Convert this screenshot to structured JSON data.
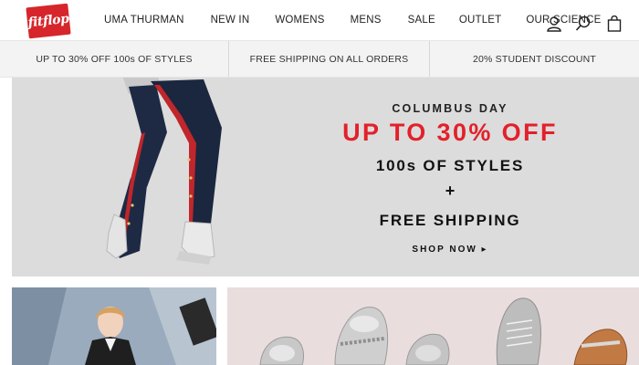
{
  "brand": {
    "logo_text": "fitflop",
    "logo_color": "#d6262b"
  },
  "nav": {
    "items": [
      {
        "label": "UMA THURMAN"
      },
      {
        "label": "NEW IN"
      },
      {
        "label": "WOMENS"
      },
      {
        "label": "MENS"
      },
      {
        "label": "SALE"
      },
      {
        "label": "OUTLET"
      },
      {
        "label": "OUR SCIENCE"
      }
    ]
  },
  "header_icons": [
    "account-icon",
    "search-icon",
    "bag-icon"
  ],
  "promo_bar": {
    "items": [
      {
        "label": "UP TO 30% OFF 100s OF STYLES"
      },
      {
        "label": "FREE SHIPPING ON ALL ORDERS"
      },
      {
        "label": "20% STUDENT DISCOUNT"
      }
    ]
  },
  "hero": {
    "occasion": "COLUMBUS DAY",
    "deal": "UP TO 30% OFF",
    "line1": "100s OF STYLES",
    "plus": "+",
    "line2": "FREE SHIPPING",
    "cta": "SHOP NOW ▸",
    "accent_color": "#e3202a",
    "background_color": "#dcdcdc"
  },
  "tiles": {
    "left_background": "#8ea0b2",
    "right_background": "#eadddd"
  }
}
